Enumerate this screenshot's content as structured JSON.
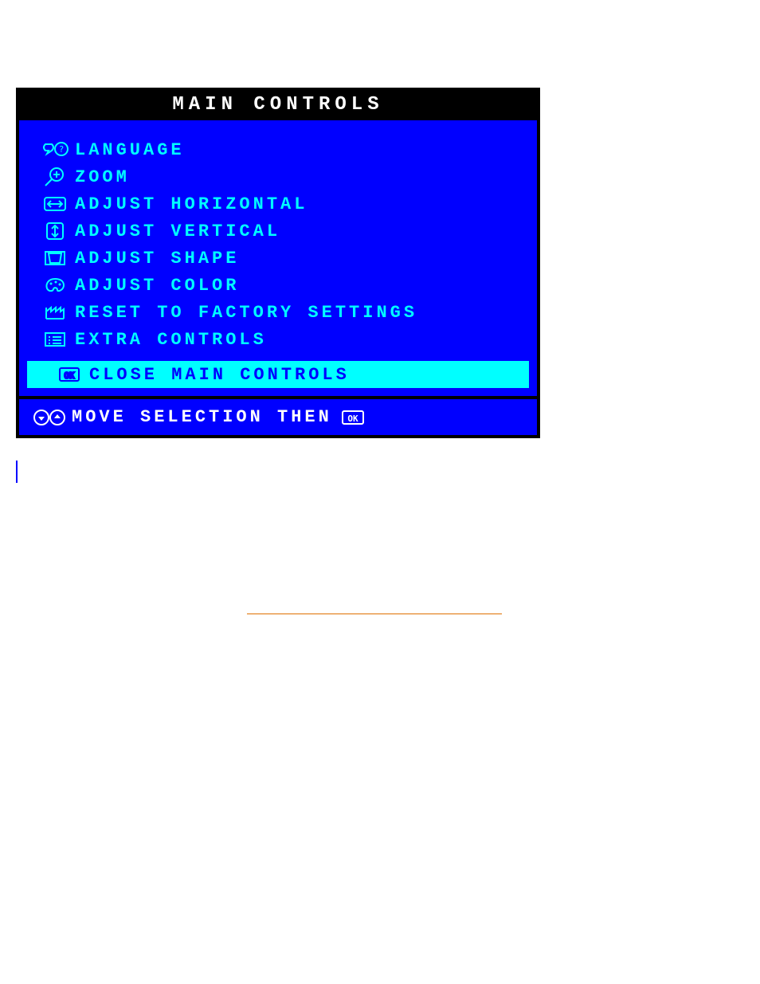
{
  "title": "MAIN CONTROLS",
  "items": [
    {
      "label": "LANGUAGE"
    },
    {
      "label": "ZOOM"
    },
    {
      "label": "ADJUST HORIZONTAL"
    },
    {
      "label": "ADJUST VERTICAL"
    },
    {
      "label": "ADJUST SHAPE"
    },
    {
      "label": "ADJUST COLOR"
    },
    {
      "label": "RESET TO FACTORY SETTINGS"
    },
    {
      "label": "EXTRA CONTROLS"
    }
  ],
  "selected": {
    "label": "CLOSE MAIN CONTROLS"
  },
  "footer": {
    "label": "MOVE SELECTION THEN"
  },
  "colors": {
    "background": "#0000ff",
    "highlight": "#00ffff",
    "text_inactive": "#00ffff",
    "text_selected": "#0000ff",
    "footer_text": "#ffffff",
    "titlebar_bg": "#000000",
    "titlebar_text": "#ffffff"
  }
}
